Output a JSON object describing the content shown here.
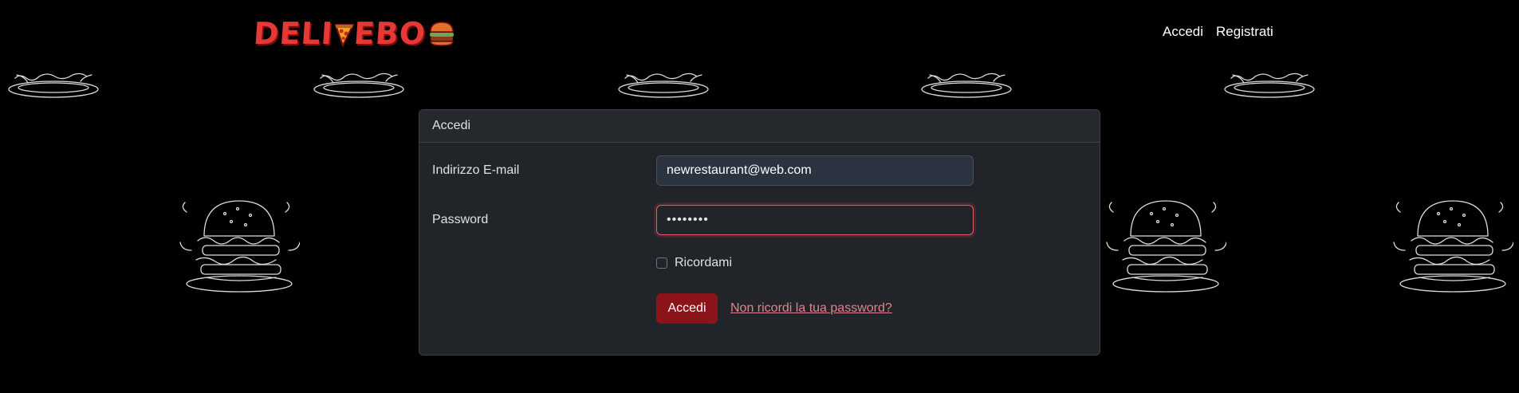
{
  "navbar": {
    "logo_text": "DELI",
    "logo_text_end": "EBO",
    "links": [
      {
        "label": "Accedi"
      },
      {
        "label": "Registrati"
      }
    ]
  },
  "card": {
    "header": "Accedi"
  },
  "form": {
    "email_label": "Indirizzo E-mail",
    "email_value": "newrestaurant@web.com",
    "password_label": "Password",
    "password_value": "••••••••",
    "remember_label": "Ricordami",
    "submit_label": "Accedi",
    "forgot_label": "Non ricordi la tua password?"
  },
  "colors": {
    "brand": "#e53935",
    "submit": "#8b1319",
    "link": "#e0838b",
    "invalid_border": "#e35d6a"
  },
  "icons": [
    "pizza-slice-icon",
    "burger-icon",
    "checkbox-icon"
  ]
}
